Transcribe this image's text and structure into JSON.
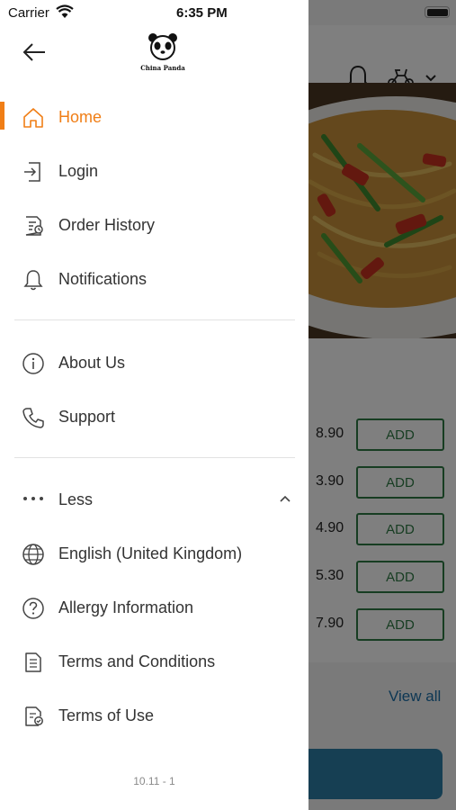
{
  "status_bar": {
    "carrier": "Carrier",
    "time": "6:35 PM"
  },
  "drawer": {
    "logo_text": "China Panda",
    "menu_primary": [
      {
        "label": "Home",
        "icon": "home-icon",
        "active": true
      },
      {
        "label": "Login",
        "icon": "login-icon",
        "active": false
      },
      {
        "label": "Order History",
        "icon": "order-history-icon",
        "active": false
      },
      {
        "label": "Notifications",
        "icon": "bell-icon",
        "active": false
      }
    ],
    "menu_info": [
      {
        "label": "About Us",
        "icon": "info-icon"
      },
      {
        "label": "Support",
        "icon": "phone-icon"
      }
    ],
    "less_toggle": {
      "label": "Less",
      "icon": "more-dots-icon",
      "expanded": true
    },
    "menu_more": [
      {
        "label": "English (United Kingdom)",
        "icon": "globe-icon"
      },
      {
        "label": "Allergy Information",
        "icon": "question-circle-icon"
      },
      {
        "label": "Terms and Conditions",
        "icon": "document-icon"
      },
      {
        "label": "Terms of Use",
        "icon": "document-check-icon"
      }
    ],
    "version": "10.11 - 1"
  },
  "background": {
    "prices": [
      "8.90",
      "3.90",
      "4.90",
      "5.30",
      "7.90"
    ],
    "add_label": "ADD",
    "view_all": "View all"
  },
  "colors": {
    "accent": "#f07e16",
    "add_green": "#2f7a45",
    "link_blue": "#1b6fa8"
  }
}
